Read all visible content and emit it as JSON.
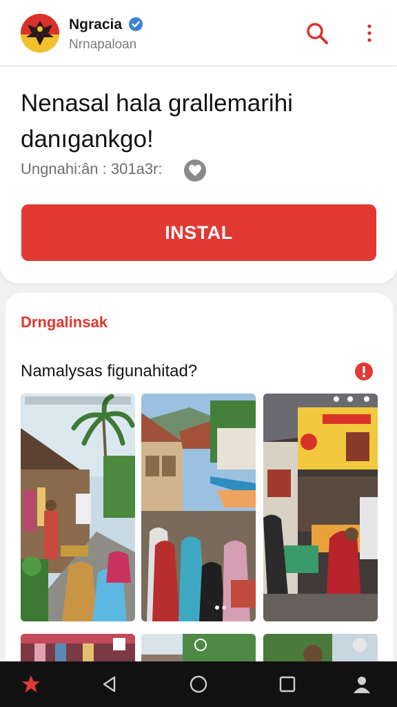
{
  "header": {
    "app_name": "Ngracia",
    "app_subtitle": "Nrnapaloan",
    "logo_icon": "emblem-logo-icon",
    "verified_icon": "verified-badge-icon",
    "search_icon": "search-icon",
    "more_icon": "more-vertical-icon"
  },
  "promo": {
    "title": "Nenasal hala grallemarihi danıgankgo!",
    "meta": "Ungnahi:ân : 301a3r:",
    "heart_icon": "heart-icon",
    "install_label": "INSTAL"
  },
  "gallery": {
    "section_title": "Drngalinsak",
    "question": "Namalysas figunahitad?",
    "alert_icon": "alert-icon",
    "photos": [
      {
        "name": "village-street-photo"
      },
      {
        "name": "market-crowd-photo"
      },
      {
        "name": "food-stall-photo"
      }
    ],
    "thumbnails": [
      {
        "name": "thumbnail-1"
      },
      {
        "name": "thumbnail-2"
      },
      {
        "name": "thumbnail-3"
      }
    ]
  },
  "navbar": {
    "items": [
      "star-icon",
      "back-icon",
      "home-icon",
      "recent-apps-icon",
      "profile-icon"
    ]
  },
  "colors": {
    "accent": "#e23a33",
    "verified": "#3b82d6",
    "navbar": "#111111"
  }
}
